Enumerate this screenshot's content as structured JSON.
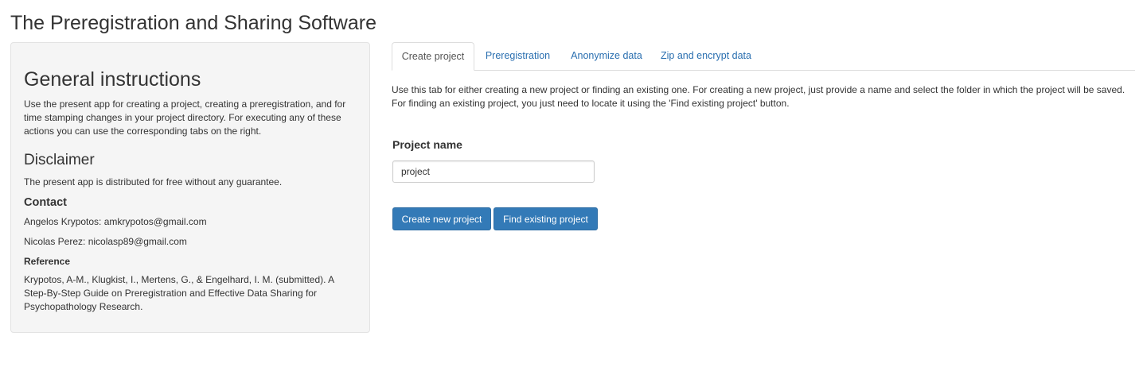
{
  "app": {
    "title": "The Preregistration and Sharing Software"
  },
  "sidebar": {
    "general_heading": "General instructions",
    "general_text": "Use the present app for creating a project, creating a preregistration, and for time stamping changes in your project directory. For executing any of these actions you can use the corresponding tabs on the right.",
    "disclaimer_heading": "Disclaimer",
    "disclaimer_text": "The present app is distributed for free without any guarantee.",
    "contact_heading": "Contact",
    "contacts": [
      "Angelos Krypotos: amkrypotos@gmail.com",
      "Nicolas Perez: nicolasp89@gmail.com"
    ],
    "reference_heading": "Reference",
    "reference_text": "Krypotos, A-M., Klugkist, I., Mertens, G., & Engelhard, I. M. (submitted). A Step-By-Step Guide on Preregistration and Effective Data Sharing for Psychopathology Research."
  },
  "tabs": [
    {
      "label": "Create project",
      "active": true
    },
    {
      "label": "Preregistration",
      "active": false
    },
    {
      "label": "Anonymize data",
      "active": false
    },
    {
      "label": "Zip and encrypt data",
      "active": false
    }
  ],
  "create_project": {
    "description": "Use this tab for either creating a new project or finding an existing one. For creating a new project, just provide a name and select the folder in which the project will be saved. For finding an existing project, you just need to locate it using the 'Find existing project' button.",
    "name_label": "Project name",
    "name_value": "project",
    "create_button": "Create new project",
    "find_button": "Find existing project"
  },
  "colors": {
    "primary": "#337ab7",
    "link": "#2a6fb0",
    "well_background": "#f5f5f5"
  }
}
